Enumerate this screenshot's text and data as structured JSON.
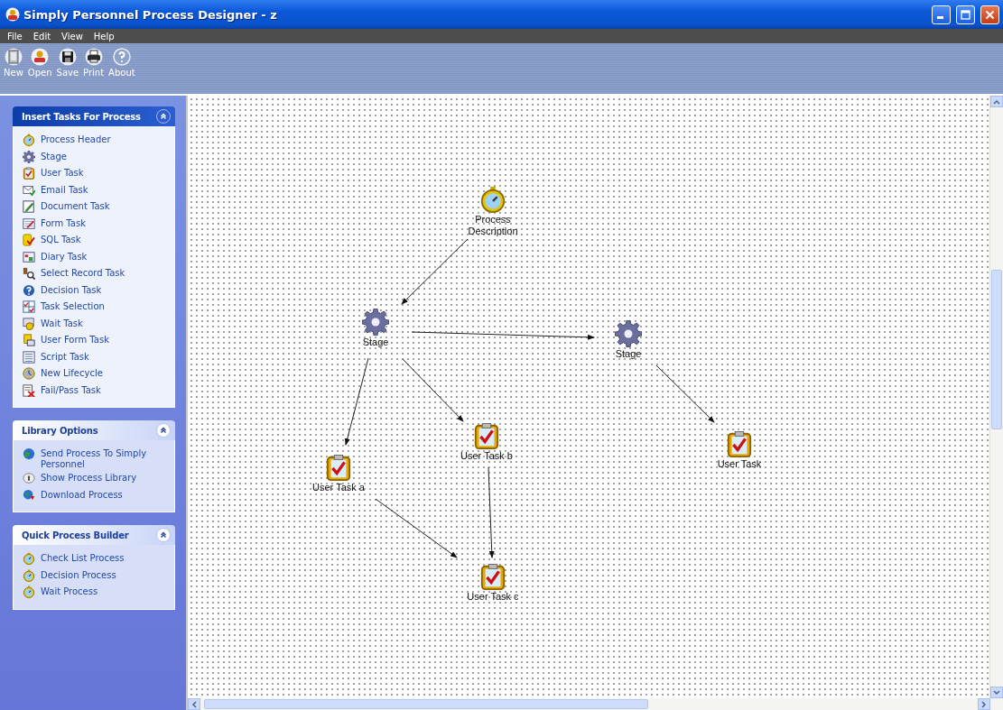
{
  "window": {
    "title": "Simply Personnel Process Designer - z"
  },
  "menu": [
    "File",
    "Edit",
    "View",
    "Help"
  ],
  "toolbar": [
    {
      "label": "New",
      "kind": "new"
    },
    {
      "label": "Open",
      "kind": "open"
    },
    {
      "label": "Save",
      "kind": "save"
    },
    {
      "label": "Print",
      "kind": "print"
    },
    {
      "label": "About",
      "kind": "about"
    }
  ],
  "sidebar": {
    "panels": [
      {
        "title": "Insert Tasks For Process",
        "special": true,
        "expanded": true,
        "items": [
          "Process Header",
          "Stage",
          "User Task",
          "Email Task",
          "Document Task",
          "Form Task",
          "SQL Task",
          "Diary Task",
          "Select Record Task",
          "Decision Task",
          "Task Selection",
          "Wait Task",
          "User Form Task",
          "Script Task",
          "New Lifecycle",
          "Fail/Pass Task"
        ]
      },
      {
        "title": "Library Options",
        "special": false,
        "expanded": true,
        "items": [
          "Send Process To Simply Personnel",
          "Show Process Library",
          "Download Process"
        ]
      },
      {
        "title": "Quick Process Builder",
        "special": false,
        "expanded": true,
        "items": [
          "Check List Process",
          "Decision Process",
          "Wait Process"
        ]
      }
    ]
  },
  "canvas": {
    "nodes": [
      {
        "label": "Process Description",
        "kind": "process"
      },
      {
        "label": "Stage",
        "kind": "stage"
      },
      {
        "label": "Stage",
        "kind": "stage"
      },
      {
        "label": "User Task b",
        "kind": "user_task"
      },
      {
        "label": "User Task",
        "kind": "user_task"
      },
      {
        "label": "User Task a",
        "kind": "user_task"
      },
      {
        "label": "User Task c",
        "kind": "user_task"
      }
    ]
  }
}
